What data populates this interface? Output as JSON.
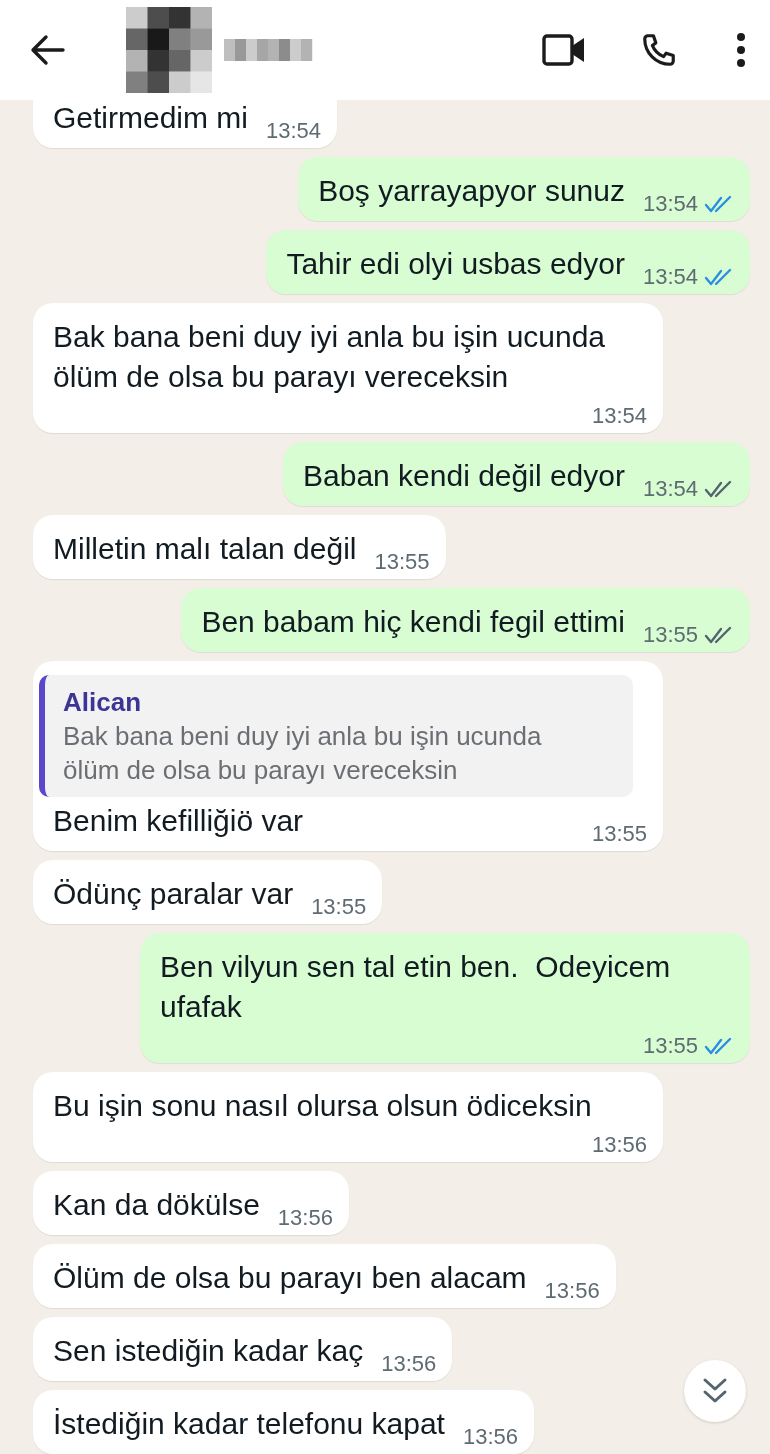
{
  "messages": [
    {
      "kind": "incoming",
      "text": "Getirmedim mi",
      "time": "13:54"
    },
    {
      "kind": "outgoing",
      "text": "Boş yarrayapyor sunuz",
      "time": "13:54",
      "read": true
    },
    {
      "kind": "outgoing",
      "text": "Tahir edi olyi usbas edyor",
      "time": "13:54",
      "read": true
    },
    {
      "kind": "incoming",
      "text": "Bak bana beni duy iyi anla bu işin ucunda ölüm de olsa bu parayı vereceksin",
      "time": "13:54"
    },
    {
      "kind": "outgoing",
      "text": "Baban kendi değil edyor",
      "time": "13:54",
      "read": false
    },
    {
      "kind": "incoming",
      "text": "Milletin malı talan değil",
      "time": "13:55"
    },
    {
      "kind": "outgoing",
      "text": "Ben babam hiç kendi fegil ettimi",
      "time": "13:55",
      "read": false
    },
    {
      "kind": "incoming",
      "text": "Benim kefilliğiö var",
      "time": "13:55",
      "quote": {
        "author": "Alican",
        "text": "Bak bana beni duy iyi anla bu işin ucunda ölüm de olsa bu parayı vereceksin"
      }
    },
    {
      "kind": "incoming",
      "text": "Ödünç paralar var",
      "time": "13:55"
    },
    {
      "kind": "outgoing",
      "text": "Ben vilyun sen tal etin ben.  Odeyicem ufafak",
      "time": "13:55",
      "read": true
    },
    {
      "kind": "incoming",
      "text": "Bu işin sonu nasıl olursa olsun ödiceksin",
      "time": "13:56"
    },
    {
      "kind": "incoming",
      "text": "Kan da dökülse",
      "time": "13:56"
    },
    {
      "kind": "incoming",
      "text": "Ölüm de olsa bu parayı ben alacam",
      "time": "13:56"
    },
    {
      "kind": "incoming",
      "text": "Sen istediğin kadar kaç",
      "time": "13:56"
    },
    {
      "kind": "incoming",
      "text": "İstediğin kadar telefonu kapat",
      "time": "13:56"
    }
  ]
}
